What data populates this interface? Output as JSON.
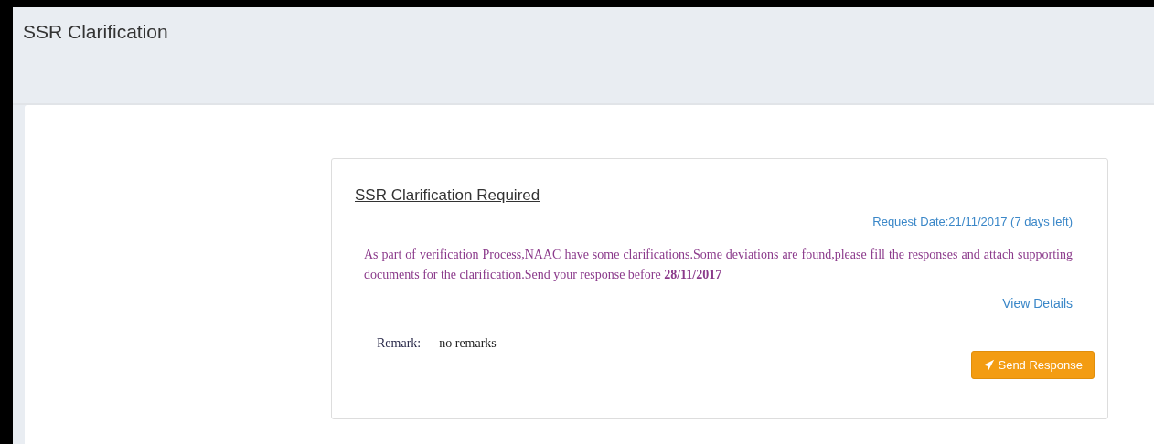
{
  "page": {
    "title": "SSR Clarification"
  },
  "card": {
    "heading": "SSR Clarification Required",
    "request_date": "Request Date:21/11/2017 (7 days left)",
    "message": "As part of verification Process,NAAC have some clarifications.Some deviations are found,please fill the responses and attach supporting documents for the clarification.Send your response before **28/11/2017**",
    "view_details": "View Details",
    "remark_label": "Remark:",
    "remark_value": "no remarks",
    "send_button": "Send Response"
  }
}
